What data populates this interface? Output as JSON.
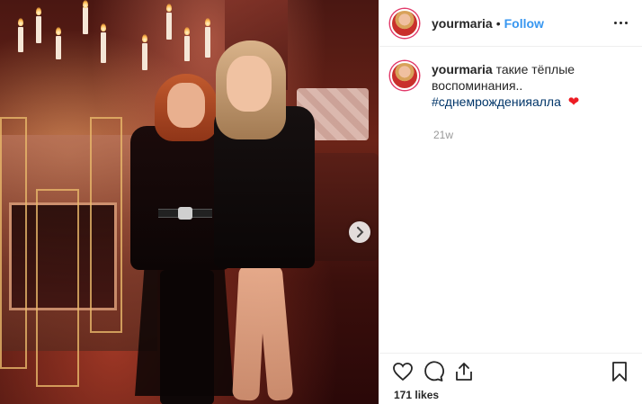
{
  "post": {
    "username": "yourmaria",
    "separator": "•",
    "follow_label": "Follow",
    "caption": {
      "username": "yourmaria",
      "text": "такие тёплые воспоминания..",
      "hashtag": "#сднемрожденияалла",
      "emoji": "❤"
    },
    "time": "21w",
    "likes": "171 likes"
  },
  "colors": {
    "follow": "#3897f0",
    "hashtag": "#003569",
    "heart": "#ed1c24",
    "story_ring": "#e23b6b"
  },
  "icons": [
    "more-options-icon",
    "heart-icon",
    "comment-icon",
    "share-icon",
    "bookmark-icon",
    "chevron-right-icon"
  ]
}
